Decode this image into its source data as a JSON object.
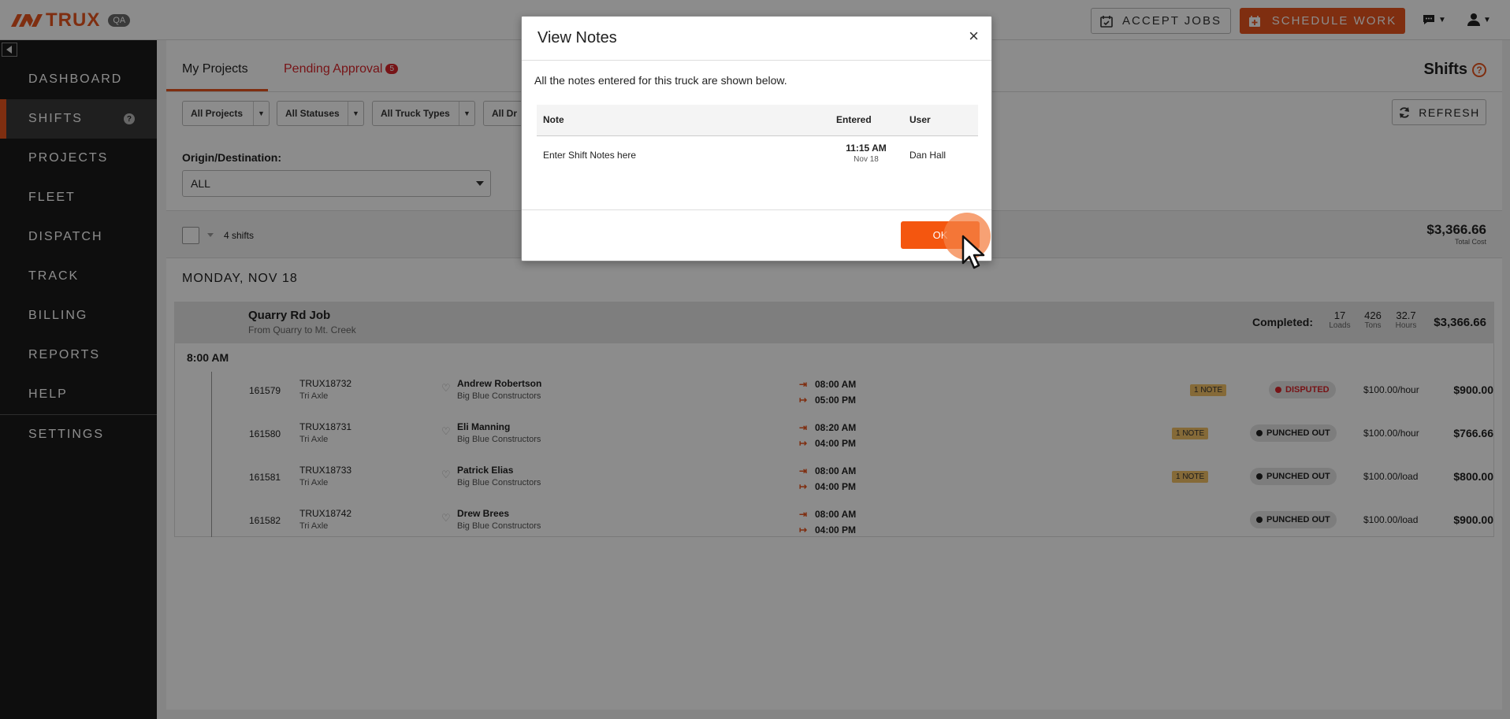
{
  "app": {
    "brand": "TRUX",
    "env_badge": "QA"
  },
  "header": {
    "accept_jobs": "ACCEPT JOBS",
    "schedule_work": "SCHEDULE WORK"
  },
  "sidebar": {
    "items": [
      {
        "label": "DASHBOARD"
      },
      {
        "label": "SHIFTS",
        "help": "?"
      },
      {
        "label": "PROJECTS"
      },
      {
        "label": "FLEET"
      },
      {
        "label": "DISPATCH"
      },
      {
        "label": "TRACK"
      },
      {
        "label": "BILLING"
      },
      {
        "label": "REPORTS"
      },
      {
        "label": "HELP"
      },
      {
        "label": "SETTINGS"
      }
    ]
  },
  "tabs": {
    "my_projects": "My Projects",
    "pending_approval": "Pending Approval",
    "pending_count": "5"
  },
  "page_title": "Shifts",
  "page_help": "?",
  "filters": [
    "All Projects",
    "All Statuses",
    "All Truck Types",
    "All Dr"
  ],
  "refresh": "REFRESH",
  "origin": {
    "label": "Origin/Destination:",
    "value": "ALL"
  },
  "summary": {
    "count": "4 shifts",
    "total": "$3,366.66",
    "total_label": "Total Cost"
  },
  "day": "MONDAY, NOV 18",
  "job": {
    "name": "Quarry Rd Job",
    "route": "From Quarry to Mt. Creek",
    "completed_label": "Completed:",
    "stats": [
      {
        "value": "17",
        "label": "Loads"
      },
      {
        "value": "426",
        "label": "Tons"
      },
      {
        "value": "32.7",
        "label": "Hours"
      }
    ],
    "cost": "$3,366.66",
    "time_group": "8:00 AM",
    "rows": [
      {
        "id": "161579",
        "truck": "TRUX18732",
        "type": "Tri Axle",
        "driver": "Andrew Robertson",
        "company": "Big Blue Constructors",
        "in": "08:00 AM",
        "out": "05:00 PM",
        "note": "1 NOTE",
        "status": "DISPUTED",
        "rate": "$100.00/hour",
        "cost": "$900.00"
      },
      {
        "id": "161580",
        "truck": "TRUX18731",
        "type": "Tri Axle",
        "driver": "Eli Manning",
        "company": "Big Blue Constructors",
        "in": "08:20 AM",
        "out": "04:00 PM",
        "note": "1 NOTE",
        "status": "PUNCHED OUT",
        "rate": "$100.00/hour",
        "cost": "$766.66"
      },
      {
        "id": "161581",
        "truck": "TRUX18733",
        "type": "Tri Axle",
        "driver": "Patrick Elias",
        "company": "Big Blue Constructors",
        "in": "08:00 AM",
        "out": "04:00 PM",
        "note": "1 NOTE",
        "status": "PUNCHED OUT",
        "rate": "$100.00/load",
        "cost": "$800.00"
      },
      {
        "id": "161582",
        "truck": "TRUX18742",
        "type": "Tri Axle",
        "driver": "Drew Brees",
        "company": "Big Blue Constructors",
        "in": "08:00 AM",
        "out": "04:00 PM",
        "note": "",
        "status": "PUNCHED OUT",
        "rate": "$100.00/load",
        "cost": "$900.00"
      }
    ]
  },
  "modal": {
    "title": "View Notes",
    "close": "×",
    "description": "All the notes entered for this truck are shown below.",
    "columns": [
      "Note",
      "Entered",
      "User"
    ],
    "notes": [
      {
        "note": "Enter Shift Notes here",
        "time": "11:15 AM",
        "date": "Nov 18",
        "user": "Dan Hall"
      }
    ],
    "ok": "OK"
  },
  "colors": {
    "accent": "#e8541e",
    "sidebar": "#1a1a1a",
    "badge_red": "#d9262b",
    "note_badge": "#f3c167"
  }
}
